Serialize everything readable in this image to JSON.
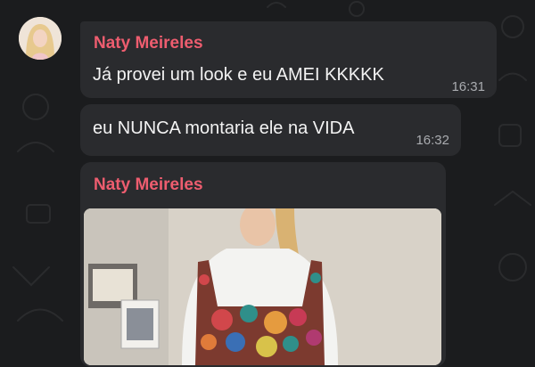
{
  "messages": [
    {
      "sender": "Naty Meireles",
      "text": "Já provei um look e eu AMEI KKKKK",
      "time": "16:31"
    },
    {
      "text": "eu NUNCA montaria ele na VIDA",
      "time": "16:32"
    },
    {
      "sender": "Naty Meireles",
      "attachment": "photo"
    }
  ],
  "colors": {
    "background": "#1b1c1e",
    "bubble": "#2a2b2e",
    "sender_name": "#ee5d6f",
    "timestamp": "#a9abaf"
  }
}
